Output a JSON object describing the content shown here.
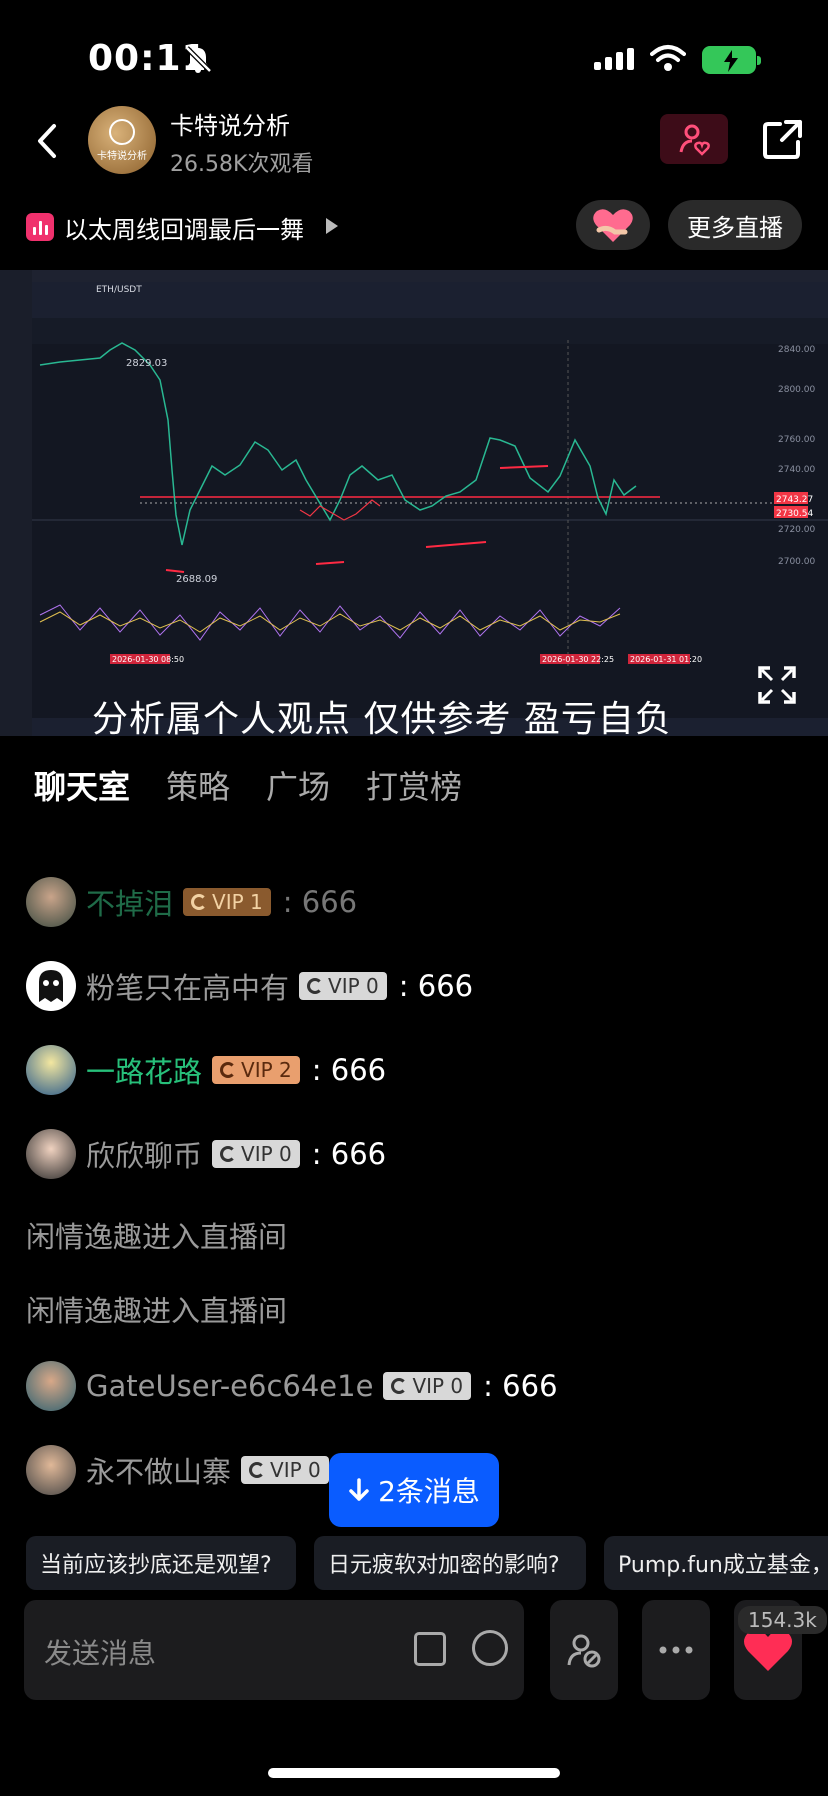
{
  "status": {
    "time": "00:11"
  },
  "header": {
    "host_name": "卡特说分析",
    "views": "26.58K次观看",
    "avatar_text": "卡特说分析"
  },
  "topic": {
    "title": "以太周线回调最后一舞",
    "more_live": "更多直播"
  },
  "video": {
    "overlay_text": "分析属个人观点 仅供参考 盈亏自负",
    "pair": "ETH/USDT",
    "prices": [
      "2829.03",
      "2688.09",
      "2743.27",
      "2730.54"
    ],
    "y_ticks": [
      "2840.00",
      "2800.00",
      "2760.00",
      "2740.00",
      "2720.00",
      "2700.00"
    ],
    "time_labels": [
      "2026-01-30 08:50",
      "2026-01-30 22:25",
      "2026-01-31 01:20"
    ]
  },
  "tabs": [
    "聊天室",
    "策略",
    "广场",
    "打赏榜"
  ],
  "chat": [
    {
      "name": "不掉泪",
      "vip": "VIP 1",
      "msg": "666"
    },
    {
      "name": "粉笔只在高中有",
      "vip": "VIP 0",
      "msg": "666"
    },
    {
      "name": "一路花路",
      "vip": "VIP 2",
      "msg": "666"
    },
    {
      "name": "欣欣聊币",
      "vip": "VIP 0",
      "msg": "666"
    },
    {
      "system": "闲情逸趣进入直播间"
    },
    {
      "system": "闲情逸趣进入直播间"
    },
    {
      "name": "GateUser-e6c64e1e",
      "vip": "VIP 0",
      "msg": "666"
    },
    {
      "name": "永不做山寨",
      "vip": "VIP 0"
    }
  ],
  "new_messages": "2条消息",
  "suggestions": [
    "当前应该抄底还是观望?",
    "日元疲软对加密的影响?",
    "Pump.fun成立基金，"
  ],
  "input": {
    "placeholder": "发送消息"
  },
  "likes": "154.3k",
  "colors": {
    "accent_blue": "#0a5cff",
    "heart": "#ff2d55",
    "green_name": "#27c07a"
  }
}
